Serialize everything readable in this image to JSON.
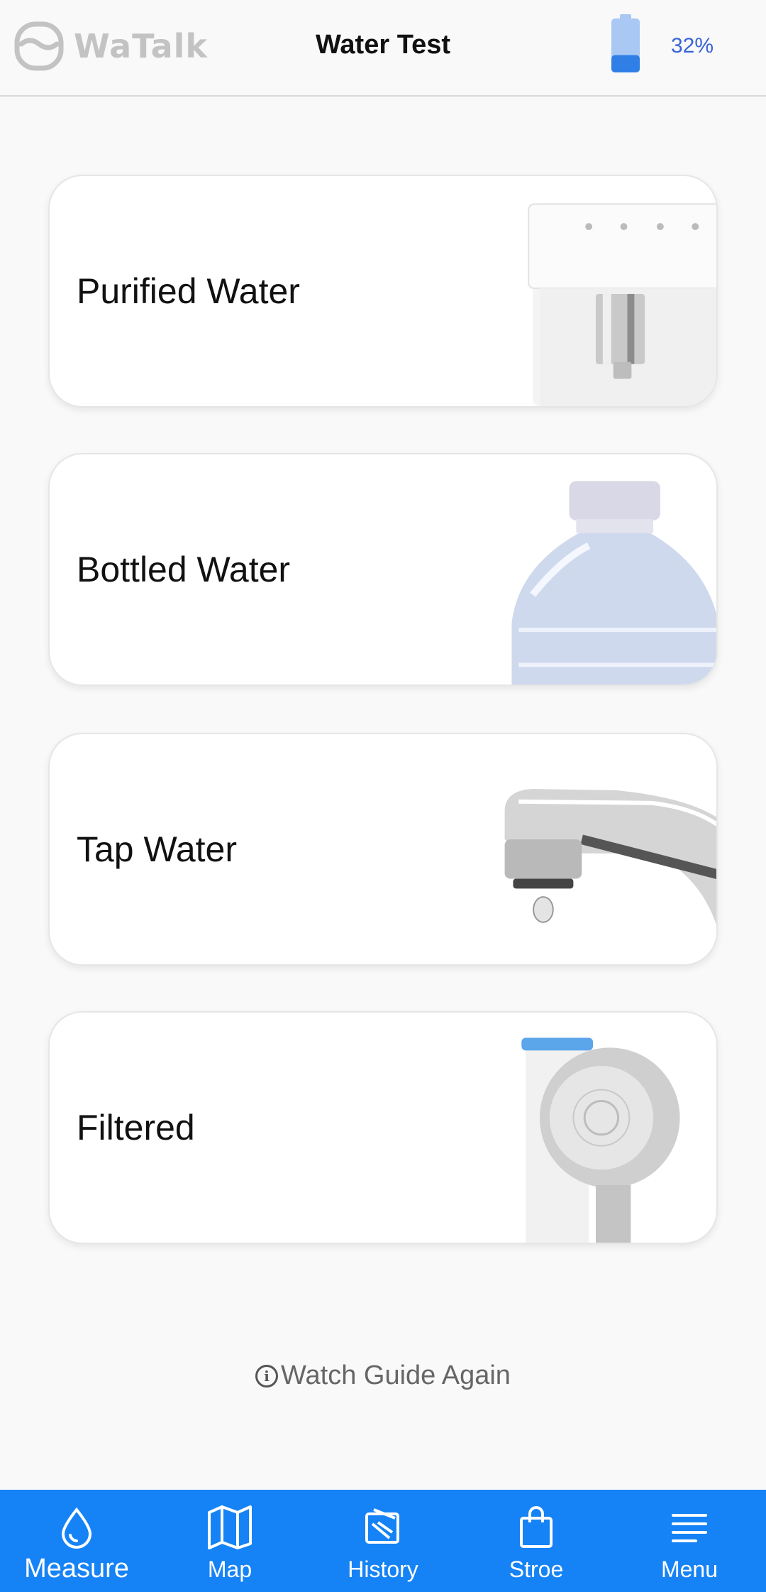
{
  "header": {
    "brand": "WaTalk",
    "title": "Water Test",
    "battery_percent": 32,
    "battery_label": "32%"
  },
  "cards": [
    {
      "label": "Purified Water",
      "image": "water-dispenser"
    },
    {
      "label": "Bottled Water",
      "image": "water-bottle"
    },
    {
      "label": "Tap Water",
      "image": "faucet"
    },
    {
      "label": "Filtered",
      "image": "filter-shower-head"
    }
  ],
  "guide": {
    "label": "Watch Guide Again",
    "icon": "info-icon"
  },
  "nav": {
    "items": [
      {
        "label": "Measure",
        "icon": "water-drop-icon",
        "active": true
      },
      {
        "label": "Map",
        "icon": "map-icon",
        "active": false
      },
      {
        "label": "History",
        "icon": "history-icon",
        "active": false
      },
      {
        "label": "Stroe",
        "icon": "shopping-bag-icon",
        "active": false
      },
      {
        "label": "Menu",
        "icon": "menu-icon",
        "active": false
      }
    ]
  },
  "colors": {
    "accent": "#1583f5",
    "battery": "#3a64d8",
    "brand": "#c3c3c3"
  }
}
